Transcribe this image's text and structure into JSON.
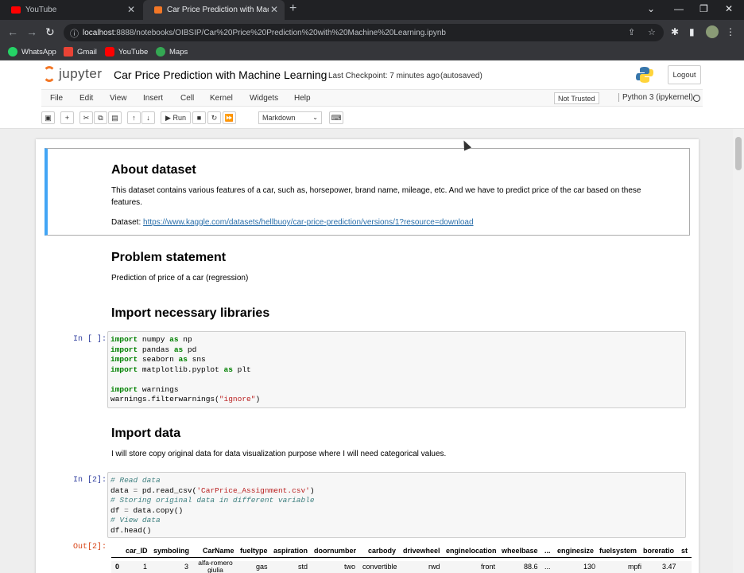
{
  "browser": {
    "tabs": [
      {
        "title": "YouTube",
        "active": false,
        "icon": "youtube-icon"
      },
      {
        "title": "Car Price Prediction with Machin",
        "active": true,
        "icon": "jupyter-icon"
      }
    ],
    "url_host": "localhost",
    "url_rest": ":8888/notebooks/OIBSIP/Car%20Price%20Prediction%20with%20Machine%20Learning.ipynb",
    "bookmarks": [
      "WhatsApp",
      "Gmail",
      "YouTube",
      "Maps"
    ]
  },
  "jupyter": {
    "logo_text": "jupyter",
    "notebook_title": "Car Price Prediction with Machine Learning",
    "checkpoint": "Last Checkpoint: 7 minutes ago",
    "autosave": "(autosaved)",
    "logout_label": "Logout",
    "menu": [
      "File",
      "Edit",
      "View",
      "Insert",
      "Cell",
      "Kernel",
      "Widgets",
      "Help"
    ],
    "trust_status": "Not Trusted",
    "kernel": "Python 3 (ipykernel)",
    "toolbar": {
      "run_label": "Run",
      "cell_type": "Markdown"
    }
  },
  "notebook": {
    "about": {
      "heading": "About dataset",
      "text": "This dataset contains various features of a car, such as, horsepower, brand name, mileage, etc. And we have to predict price of the car based on these features.",
      "dataset_label": "Dataset: ",
      "dataset_link": "https://www.kaggle.com/datasets/hellbuoy/car-price-prediction/versions/1?resource=download"
    },
    "problem": {
      "heading": "Problem statement",
      "text": "Prediction of price of a car (regression)"
    },
    "imports": {
      "heading": "Import necessary libraries",
      "prompt": "In [ ]:"
    },
    "import_data": {
      "heading": "Import data",
      "text": "I will store copy original data for data visualization purpose where I will need categorical values.",
      "prompt_in": "In [2]:",
      "prompt_out": "Out[2]:"
    },
    "dataframe": {
      "columns": [
        "car_ID",
        "symboling",
        "CarName",
        "fueltype",
        "aspiration",
        "doornumber",
        "carbody",
        "drivewheel",
        "enginelocation",
        "wheelbase",
        "...",
        "enginesize",
        "fuelsystem",
        "boreratio",
        "st"
      ],
      "row0": [
        "0",
        "1",
        "3",
        "alfa-romero giulia",
        "gas",
        "std",
        "two",
        "convertible",
        "rwd",
        "front",
        "88.6",
        "...",
        "130",
        "mpfi",
        "3.47"
      ]
    }
  }
}
